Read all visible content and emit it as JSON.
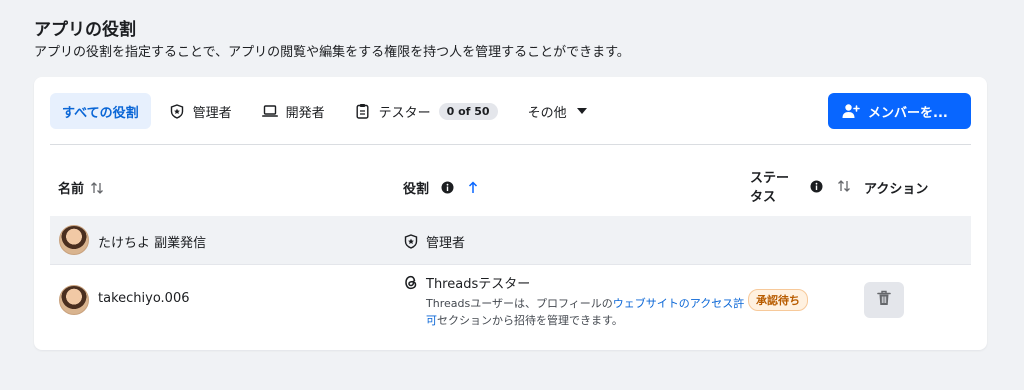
{
  "header": {
    "title": "アプリの役割",
    "subtitle": "アプリの役割を指定することで、アプリの閲覧や編集をする権限を持つ人を管理することができます。"
  },
  "tabs": [
    {
      "label": "すべての役割",
      "icon": "none",
      "active": true
    },
    {
      "label": "管理者",
      "icon": "shield-star-icon"
    },
    {
      "label": "開発者",
      "icon": "laptop-icon"
    },
    {
      "label": "テスター",
      "icon": "clipboard-icon",
      "count": "0 of 50"
    },
    {
      "label": "その他",
      "icon": "caret-down-icon"
    }
  ],
  "add_button": {
    "label": "メンバーを..."
  },
  "table": {
    "headers": {
      "name": "名前",
      "role": "役割",
      "status_line1": "ステー",
      "status_line2": "タス",
      "action": "アクション"
    },
    "rows": [
      {
        "name": "たけちよ 副業発信",
        "role": "管理者",
        "role_icon": "shield-star-icon"
      },
      {
        "name": "takechiyo.006",
        "role": "Threadsテスター",
        "role_icon": "threads-icon",
        "desc_part1": "Threadsユーザーは、プロフィールの",
        "desc_link": "ウェブサイトのアクセス許可",
        "desc_part2": "セクションから招待を管理できます。",
        "status": "承認待ち",
        "action_icon": "trash-icon"
      }
    ]
  },
  "colors": {
    "accent": "#0866ff",
    "tab_active_bg": "#e7f0fd",
    "status_pending": "#b85c00",
    "background": "#f0f2f5"
  }
}
